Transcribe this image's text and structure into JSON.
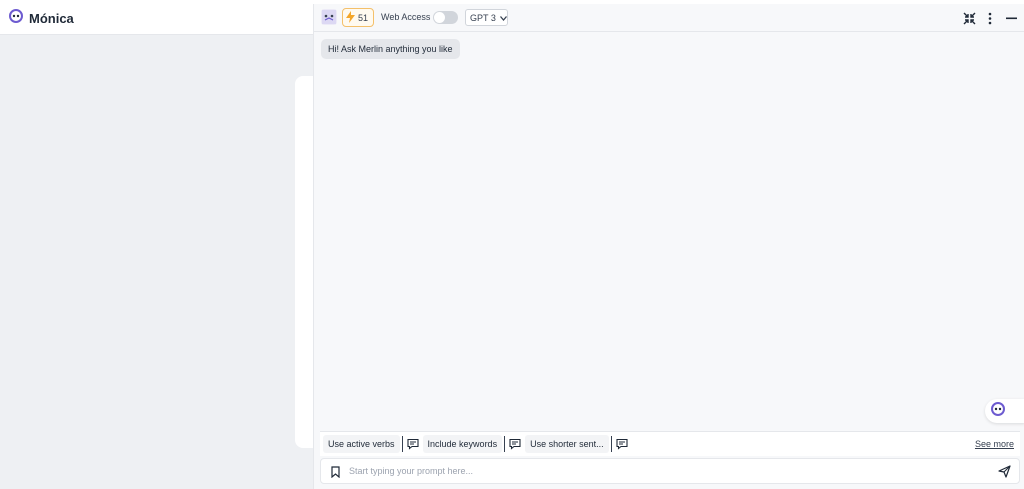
{
  "background_app": {
    "logo_text": "Mónica"
  },
  "panel": {
    "header": {
      "query_count": "51",
      "web_access_label": "Web Access",
      "web_access_enabled": false,
      "model_selected": "GPT 3"
    },
    "greeting": "Hi! Ask Merlin anything you like",
    "suggestions": [
      {
        "label": "Use active verbs"
      },
      {
        "label": "Include keywords"
      },
      {
        "label": "Use shorter sent..."
      }
    ],
    "see_more_label": "See more",
    "input": {
      "placeholder": "Start typing your prompt here...",
      "value": ""
    }
  },
  "colors": {
    "brand_purple": "#6d5bd0",
    "badge_orange": "#f4a62a",
    "background": "#eef0f3"
  }
}
